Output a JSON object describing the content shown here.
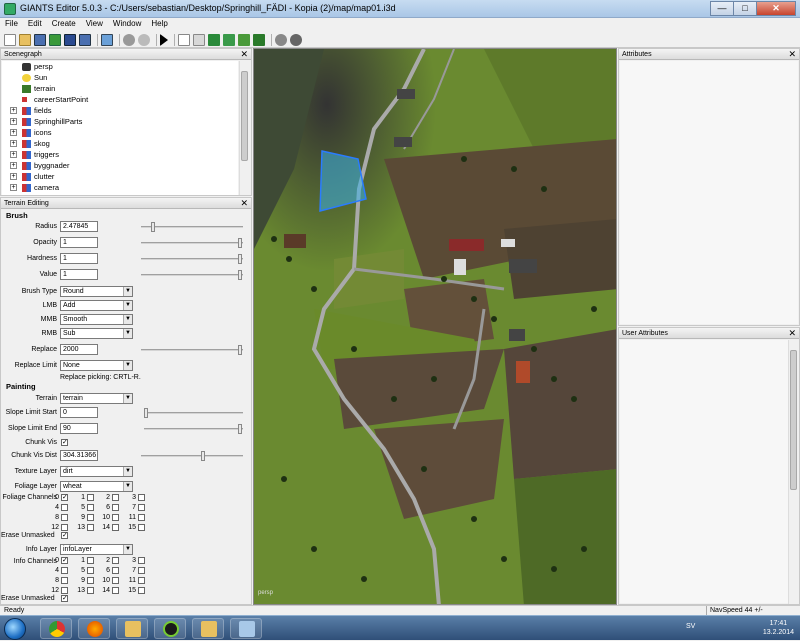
{
  "window": {
    "title": "GIANTS Editor 5.0.3 - C:/Users/sebastian/Desktop/Springhill_FÄDI - Kopia (2)/map/map01.i3d",
    "min": "—",
    "max": "□",
    "close": "✕"
  },
  "menu": [
    "File",
    "Edit",
    "Create",
    "View",
    "Window",
    "Help"
  ],
  "scenegraph": {
    "title": "Scenegraph",
    "items": [
      {
        "label": "persp",
        "icon": "camera-icon",
        "expandable": false
      },
      {
        "label": "Sun",
        "icon": "light-icon",
        "expandable": false
      },
      {
        "label": "terrain",
        "icon": "terrain-icon",
        "expandable": false
      },
      {
        "label": "careerStartPoint",
        "icon": "transform-icon",
        "expandable": false
      },
      {
        "label": "fields",
        "icon": "group-icon",
        "expandable": true
      },
      {
        "label": "SpringhillParts",
        "icon": "group-icon",
        "expandable": true
      },
      {
        "label": "icons",
        "icon": "group-icon",
        "expandable": true
      },
      {
        "label": "skog",
        "icon": "group-icon",
        "expandable": true
      },
      {
        "label": "triggers",
        "icon": "group-icon",
        "expandable": true
      },
      {
        "label": "byggnader",
        "icon": "group-icon",
        "expandable": true
      },
      {
        "label": "clutter",
        "icon": "group-icon",
        "expandable": true
      },
      {
        "label": "camera",
        "icon": "group-icon",
        "expandable": true
      }
    ]
  },
  "terrain_editing": {
    "title": "Terrain Editing",
    "brush_heading": "Brush",
    "radius_label": "Radius",
    "radius_value": "2.47845",
    "opacity_label": "Opacity",
    "opacity_value": "1",
    "hardness_label": "Hardness",
    "hardness_value": "1",
    "value_label": "Value",
    "value_value": "1",
    "brush_type_label": "Brush Type",
    "brush_type_value": "Round",
    "lmb_label": "LMB",
    "lmb_value": "Add",
    "mmb_label": "MMB",
    "mmb_value": "Smooth",
    "rmb_label": "RMB",
    "rmb_value": "Sub",
    "replace_label": "Replace",
    "replace_value": "2000",
    "replace_limit_label": "Replace Limit",
    "replace_limit_value": "None",
    "replace_picking": "Replace picking: CRTL-R.",
    "painting_heading": "Painting",
    "terrain_label": "Terrain",
    "terrain_value": "terrain",
    "slope_start_label": "Slope Limit Start",
    "slope_start_value": "0",
    "slope_end_label": "Slope Limit End",
    "slope_end_value": "90",
    "chunk_vis_label": "Chunk Vis",
    "chunk_vis_dist_label": "Chunk Vis Dist",
    "chunk_vis_dist_value": "304.31366",
    "texture_layer_label": "Texture Layer",
    "texture_layer_value": "dirt",
    "foliage_layer_label": "Foliage Layer",
    "foliage_layer_value": "wheat",
    "foliage_channels_label": "Foliage Channels",
    "erase_unmasked_label": "Erase Unmasked",
    "info_layer_label": "Info Layer",
    "info_layer_value": "infoLayer",
    "info_channels_label": "Info Channels",
    "erase_unmasked2_label": "Erase Unmasked",
    "channels": [
      "0",
      "1",
      "2",
      "3",
      "4",
      "5",
      "6",
      "7",
      "8",
      "9",
      "10",
      "11",
      "12",
      "13",
      "14",
      "15"
    ]
  },
  "viewport": {
    "label": "persp"
  },
  "attributes": {
    "title": "Attributes"
  },
  "user_attributes": {
    "title": "User Attributes"
  },
  "status": {
    "left": "Ready",
    "right": "NavSpeed 44 +/-"
  },
  "taskbar": {
    "lang": "SV",
    "time": "17:41",
    "date": "13.2.2014"
  }
}
